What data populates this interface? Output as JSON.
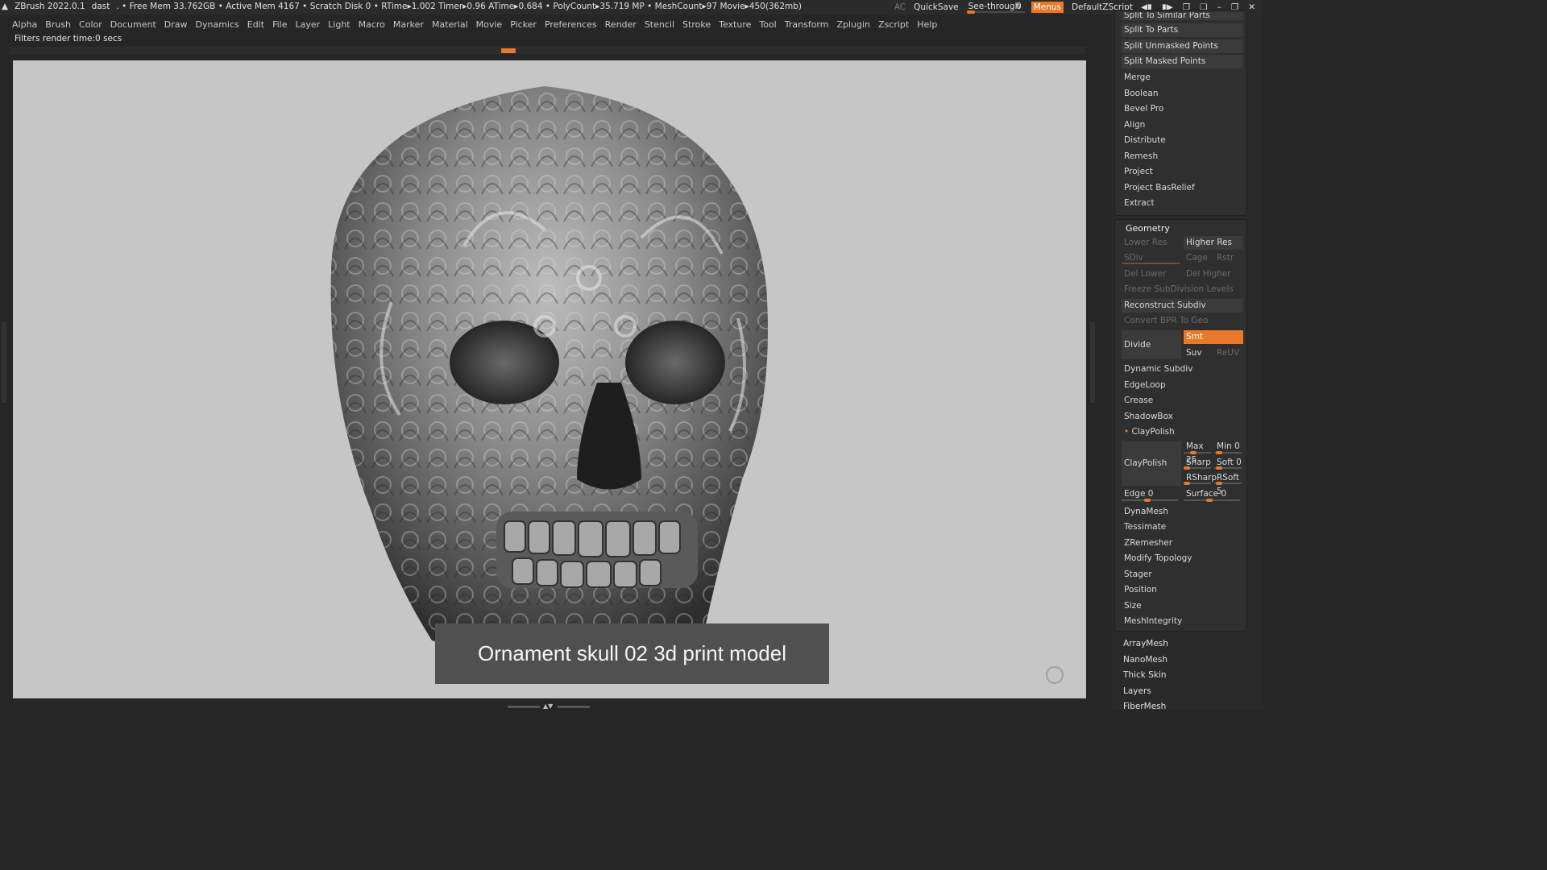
{
  "title_bar": {
    "app": "ZBrush 2022.0.1",
    "doc": "dast",
    "stats": ". • Free Mem 33.762GB • Active Mem 4167 • Scratch Disk 0 •  RTime▸1.002 Timer▸0.96 ATime▸0.684 • PolyCount▸35.719 MP  • MeshCount▸97  Movie▸450(362mb)",
    "ac": "AC",
    "quicksave": "QuickSave",
    "see_through_label": "See-through",
    "see_through_value": "0",
    "menus": "Menus",
    "default_zscript": "DefaultZScript"
  },
  "menu": [
    "Alpha",
    "Brush",
    "Color",
    "Document",
    "Draw",
    "Dynamics",
    "Edit",
    "File",
    "Layer",
    "Light",
    "Macro",
    "Marker",
    "Material",
    "Movie",
    "Picker",
    "Preferences",
    "Render",
    "Stencil",
    "Stroke",
    "Texture",
    "Tool",
    "Transform",
    "Zplugin",
    "Zscript",
    "Help"
  ],
  "status": "Filters render time:0 secs",
  "caption": "Ornament skull 02 3d print model",
  "panel": {
    "cut_top": "Split To Similar Parts",
    "subtool_buttons": [
      "Split To Parts",
      "Split Unmasked Points",
      "Split Masked Points"
    ],
    "subtool_items": [
      "Merge",
      "Boolean",
      "Bevel Pro",
      "Align",
      "Distribute",
      "Remesh",
      "Project",
      "Project BasRelief",
      "Extract"
    ],
    "geometry": {
      "title": "Geometry",
      "lower_res": "Lower Res",
      "higher_res": "Higher Res",
      "sdiv": "SDiv",
      "cage": "Cage",
      "rstr": "Rstr",
      "del_lower": "Del Lower",
      "del_higher": "Del Higher",
      "freeze": "Freeze SubDivision Levels",
      "reconstruct": "Reconstruct Subdiv",
      "convert_bpr": "Convert BPR To Geo",
      "divide": "Divide",
      "smt": "Smt",
      "suv": "Suv",
      "reuv": "ReUV",
      "dynamic_subdiv": "Dynamic Subdiv",
      "edgeloop": "EdgeLoop",
      "crease": "Crease",
      "shadowbox": "ShadowBox",
      "claypolish_header": "ClayPolish",
      "claypolish_btn": "ClayPolish",
      "max_label": "Max",
      "max_val": "25",
      "min_label": "Min",
      "min_val": "0",
      "sharp_label": "Sharp",
      "soft_label": "Soft",
      "soft_val": "0",
      "rsharp_label": "RSharp",
      "rsoft_label": "RSoft",
      "rsoft_val": "5",
      "edge_label": "Edge",
      "edge_val": "0",
      "surface_label": "Surface",
      "surface_val": "0",
      "more": [
        "DynaMesh",
        "Tessimate",
        "ZRemesher",
        "Modify Topology",
        "Stager",
        "Position",
        "Size",
        "MeshIntegrity"
      ]
    },
    "tool_sections": [
      "ArrayMesh",
      "NanoMesh",
      "Thick Skin",
      "Layers",
      "FiberMesh"
    ]
  }
}
